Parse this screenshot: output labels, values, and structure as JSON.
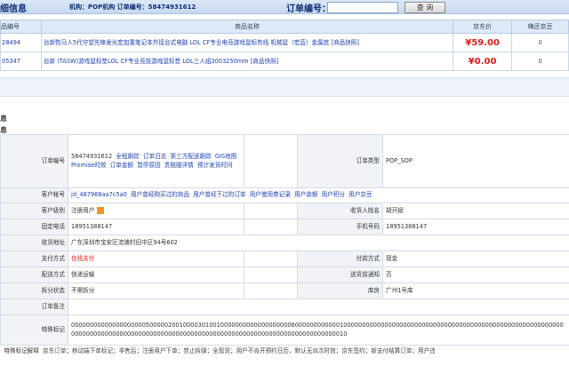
{
  "header": {
    "title": "细信息",
    "org": "机构：POP机构 订单编号：58474931612",
    "query_label": "订单编号：",
    "query_value": "",
    "query_button": "查 询"
  },
  "products": {
    "columns": [
      "品编号",
      "商品名称",
      "京东价",
      "嗨还京豆"
    ],
    "rows": [
      {
        "id": "28494",
        "name": "台新牧马人5代守望先锋发光宏加重笔记本外接台式电脑 LOL CF专业电竞游戏鼠标有线 机械鼠（宏蓝）金属底",
        "flag": "[商品快照]",
        "price": "¥59.00",
        "beans": "0"
      },
      {
        "id": "05347",
        "name": "台新 (TASW)游戏鼠标垫LOL CF专业竞技游戏鼠标垫 LOL三人组3003250mm",
        "flag": "[商品快照]",
        "price": "¥0.00",
        "beans": "0"
      }
    ]
  },
  "sections": {
    "s1": "息",
    "s2": "息"
  },
  "detail": {
    "order_no_label": "订单编号",
    "order_no": "58474931612",
    "order_links": [
      "全程跟踪",
      "订单日志",
      "第三方配送跟踪",
      "GIS地图",
      "Promise时效",
      "订单金额",
      "暂停原因",
      "责赔赔详情",
      "预计发货时间"
    ],
    "order_type_label": "订单类型",
    "order_type": "POP_SOP",
    "customer_account_label": "客户帐号",
    "customer_account": "jd_487968aa7c5a0",
    "customer_links": [
      "用户曾经购买过的商品",
      "用户曾经下过的订单",
      "用户使用券记录",
      "用户余额",
      "用户积分",
      "用户京豆"
    ],
    "customer_level_label": "客户级别",
    "customer_level": "注册用户",
    "receiver_label": "收货人姓名",
    "receiver": "胡开斌",
    "phone_label": "固定电话",
    "phone": "18951388147",
    "mobile_label": "手机号码",
    "mobile": "18951388147",
    "address_label": "收货地址",
    "address": "广东深圳市宝安区流塘村旧中区94号602",
    "pay_type_label": "支付方式",
    "pay_type": "在线支付",
    "pay_method_label": "付款方式",
    "pay_method": "现金",
    "delivery_label": "配送方式",
    "delivery": "快递运输",
    "notify_label": "送货前通知",
    "notify": "否",
    "split_label": "拆分状态",
    "split": "不需拆分",
    "warehouse_label": "库房",
    "warehouse": "广州1号库",
    "remark_label": "订单备注",
    "remark": "",
    "special_label": "特殊标记",
    "special": "00000000000000000000500000200100003010010000000000000000000600000000000010000000000000000000000000000000000000000000000000000000000000000000000000000000000000000000000000000000000000000000000000000000000010"
  },
  "footer": {
    "label": "特殊标记解释",
    "text": "京东订单；移动端下单标记；非售后；注册用户下单；禁止拆弹；全现货；用户不肯开预约日历，默认无派次时效；京东签约；新支付结算订单；用户违"
  }
}
